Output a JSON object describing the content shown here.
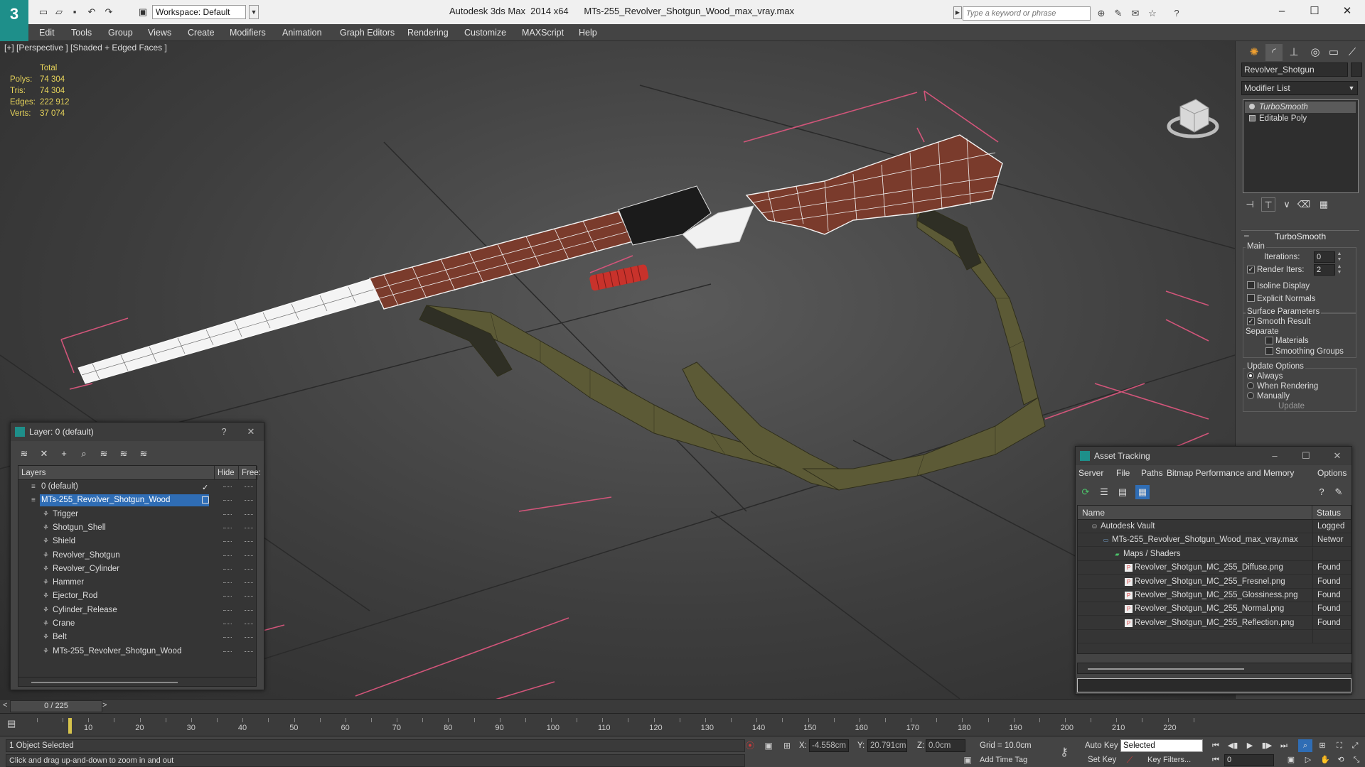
{
  "titlebar": {
    "logo": "3",
    "workspace": "Workspace: Default",
    "app_title": "Autodesk 3ds Max  2014 x64      MTs-255_Revolver_Shotgun_Wood_max_vray.max",
    "search_placeholder": "Type a keyword or phrase",
    "minimize": "–",
    "maximize": "☐",
    "close": "✕"
  },
  "menu": [
    "Edit",
    "Tools",
    "Group",
    "Views",
    "Create",
    "Modifiers",
    "Animation",
    "Graph Editors",
    "Rendering",
    "Customize",
    "MAXScript",
    "Help"
  ],
  "viewport": {
    "label": "[+] [Perspective ] [Shaded + Edged Faces ]",
    "stats_total": "Total",
    "stats": [
      {
        "label": "Polys:",
        "value": "74 304"
      },
      {
        "label": "Tris:",
        "value": "74 304"
      },
      {
        "label": "Edges:",
        "value": "222 912"
      },
      {
        "label": "Verts:",
        "value": "37 074"
      }
    ]
  },
  "command_panel": {
    "object_name": "Revolver_Shotgun",
    "modifier_list": "Modifier List",
    "stack": [
      {
        "label": "TurboSmooth",
        "selected": true
      },
      {
        "label": "Editable Poly",
        "selected": false
      }
    ],
    "rollout_title": "TurboSmooth",
    "main_group": "Main",
    "iterations_label": "Iterations:",
    "iterations_value": "0",
    "render_iters_label": "Render Iters:",
    "render_iters_value": "2",
    "isoline_label": "Isoline Display",
    "explicit_normals_label": "Explicit Normals",
    "surface_params_group": "Surface Parameters",
    "smooth_result_label": "Smooth Result",
    "separate_label": "Separate",
    "materials_label": "Materials",
    "smoothing_groups_label": "Smoothing Groups",
    "update_options_group": "Update Options",
    "always_label": "Always",
    "when_rendering_label": "When Rendering",
    "manually_label": "Manually",
    "update_button": "Update"
  },
  "layer_dialog": {
    "title": "Layer: 0 (default)",
    "help": "?",
    "close": "✕",
    "col_layers": "Layers",
    "col_hide": "Hide",
    "col_freeze": "Free:",
    "rows": [
      {
        "name": "0 (default)",
        "level": 0,
        "selected": false,
        "current": true
      },
      {
        "name": "MTs-255_Revolver_Shotgun_Wood",
        "level": 0,
        "selected": true,
        "current": false
      },
      {
        "name": "Trigger",
        "level": 1,
        "selected": false,
        "current": false
      },
      {
        "name": "Shotgun_Shell",
        "level": 1,
        "selected": false,
        "current": false
      },
      {
        "name": "Shield",
        "level": 1,
        "selected": false,
        "current": false
      },
      {
        "name": "Revolver_Shotgun",
        "level": 1,
        "selected": false,
        "current": false
      },
      {
        "name": "Revolver_Cylinder",
        "level": 1,
        "selected": false,
        "current": false
      },
      {
        "name": "Hammer",
        "level": 1,
        "selected": false,
        "current": false
      },
      {
        "name": "Ejector_Rod",
        "level": 1,
        "selected": false,
        "current": false
      },
      {
        "name": "Cylinder_Release",
        "level": 1,
        "selected": false,
        "current": false
      },
      {
        "name": "Crane",
        "level": 1,
        "selected": false,
        "current": false
      },
      {
        "name": "Belt",
        "level": 1,
        "selected": false,
        "current": false
      },
      {
        "name": "MTs-255_Revolver_Shotgun_Wood",
        "level": 1,
        "selected": false,
        "current": false
      }
    ]
  },
  "asset_dialog": {
    "title": "Asset Tracking",
    "menu": [
      "Server",
      "File",
      "Paths",
      "Bitmap Performance and Memory",
      "Options"
    ],
    "col_name": "Name",
    "col_status": "Status",
    "rows": [
      {
        "name": "Autodesk Vault",
        "status": "Logged",
        "level": 0,
        "icon": "vault-icon"
      },
      {
        "name": "MTs-255_Revolver_Shotgun_Wood_max_vray.max",
        "status": "Networ",
        "level": 1,
        "icon": "max-file-icon"
      },
      {
        "name": "Maps / Shaders",
        "status": "",
        "level": 2,
        "icon": "maps-icon"
      },
      {
        "name": "Revolver_Shotgun_MC_255_Diffuse.png",
        "status": "Found",
        "level": 3,
        "icon": "png-icon"
      },
      {
        "name": "Revolver_Shotgun_MC_255_Fresnel.png",
        "status": "Found",
        "level": 3,
        "icon": "png-icon"
      },
      {
        "name": "Revolver_Shotgun_MC_255_Glossiness.png",
        "status": "Found",
        "level": 3,
        "icon": "png-icon"
      },
      {
        "name": "Revolver_Shotgun_MC_255_Normal.png",
        "status": "Found",
        "level": 3,
        "icon": "png-icon"
      },
      {
        "name": "Revolver_Shotgun_MC_255_Reflection.png",
        "status": "Found",
        "level": 3,
        "icon": "png-icon"
      }
    ]
  },
  "timeline": {
    "frame_counter": "0 / 225",
    "prev": "<",
    "next": ">",
    "ticks": [
      "10",
      "20",
      "30",
      "40",
      "50",
      "60",
      "70",
      "80",
      "90",
      "100",
      "110",
      "120",
      "130",
      "140",
      "150",
      "160",
      "170",
      "180",
      "190",
      "200",
      "210",
      "220"
    ]
  },
  "status": {
    "selection": "1 Object Selected",
    "hint": "Click and drag up-and-down to zoom in and out",
    "x_label": "X:",
    "x_value": "-4.558cm",
    "y_label": "Y:",
    "y_value": "20.791cm",
    "z_label": "Z:",
    "z_value": "0.0cm",
    "grid": "Grid = 10.0cm",
    "add_time_tag": "Add Time Tag",
    "auto_key": "Auto Key",
    "set_key": "Set Key",
    "selected_option": "Selected",
    "key_filters": "Key Filters...",
    "frame_value": "0"
  }
}
